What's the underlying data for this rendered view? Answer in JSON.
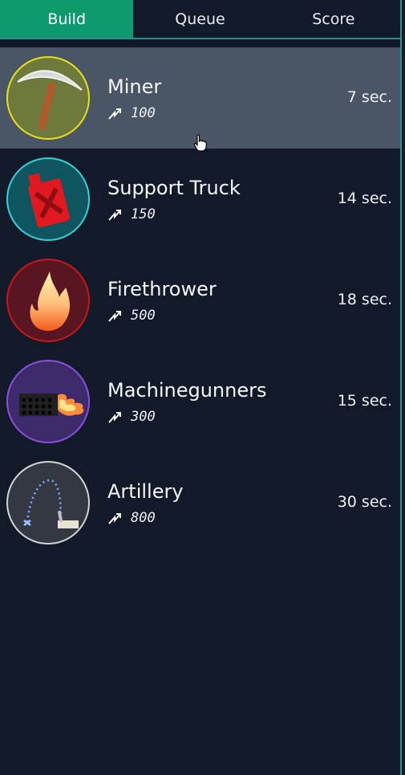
{
  "tabs": [
    {
      "label": "Build",
      "active": true
    },
    {
      "label": "Queue",
      "active": false
    },
    {
      "label": "Score",
      "active": false
    }
  ],
  "units": [
    {
      "name": "Miner",
      "cost": "100",
      "time": "7 sec.",
      "icon": "pickaxe-icon",
      "ring_color": "#e6e21a",
      "bg_color": "#6e7a3c",
      "selected": true
    },
    {
      "name": "Support Truck",
      "cost": "150",
      "time": "14 sec.",
      "icon": "fuel-canister-icon",
      "ring_color": "#2fd3d8",
      "bg_color": "#0f5560",
      "selected": false
    },
    {
      "name": "Firethrower",
      "cost": "500",
      "time": "18 sec.",
      "icon": "flame-icon",
      "ring_color": "#c8161c",
      "bg_color": "#5a1620",
      "selected": false
    },
    {
      "name": "Machinegunners",
      "cost": "300",
      "time": "15 sec.",
      "icon": "machinegun-fire-icon",
      "ring_color": "#8a4fdb",
      "bg_color": "#3c2a6a",
      "selected": false
    },
    {
      "name": "Artillery",
      "cost": "800",
      "time": "30 sec.",
      "icon": "artillery-arc-icon",
      "ring_color": "#d4d4d4",
      "bg_color": "#343842",
      "selected": false
    }
  ],
  "colors": {
    "accent": "#0e9a6e",
    "background": "#121a2a",
    "selected_row": "#4a5565",
    "divider": "#2a8f92"
  }
}
